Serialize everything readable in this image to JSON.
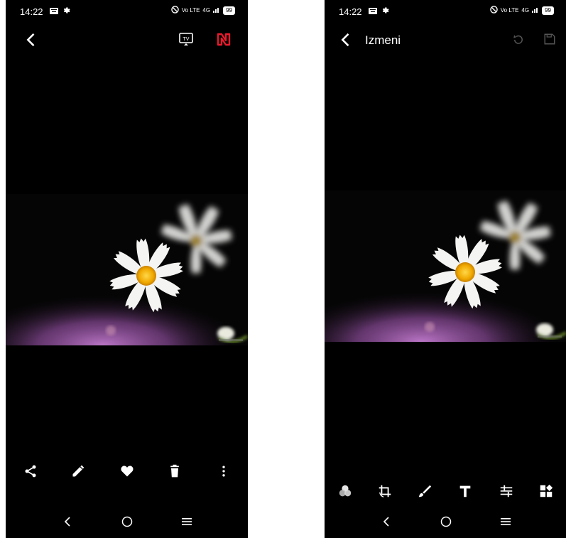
{
  "status": {
    "time": "14:22",
    "volte": "Vo LTE",
    "network": "4G",
    "battery": "99"
  },
  "viewer": {
    "icons": {
      "back": "back-arrow-icon",
      "cast": "cast-tv-icon",
      "app_logo": "nfc-logo-icon"
    },
    "toolbar": [
      "share-icon",
      "edit-pencil-icon",
      "favorite-heart-icon",
      "delete-trash-icon",
      "more-vert-icon"
    ]
  },
  "editor": {
    "title": "Izmeni",
    "icons": {
      "back": "back-arrow-icon",
      "undo": "undo-icon",
      "save": "save-icon"
    },
    "toolbar": [
      "filter-circles-icon",
      "crop-rotate-icon",
      "brush-icon",
      "text-icon",
      "adjust-sliders-icon",
      "stickers-icon"
    ]
  },
  "navigation": [
    "nav-back-icon",
    "nav-home-icon",
    "nav-menu-icon"
  ],
  "colors": {
    "background": "#000000",
    "foreground": "#ffffff",
    "accent": "#e8192c",
    "disabled": "#555555",
    "petal": "#f4f4f2",
    "flower_center": "#f2b500",
    "bokeh_pink": "#b86bc4"
  }
}
